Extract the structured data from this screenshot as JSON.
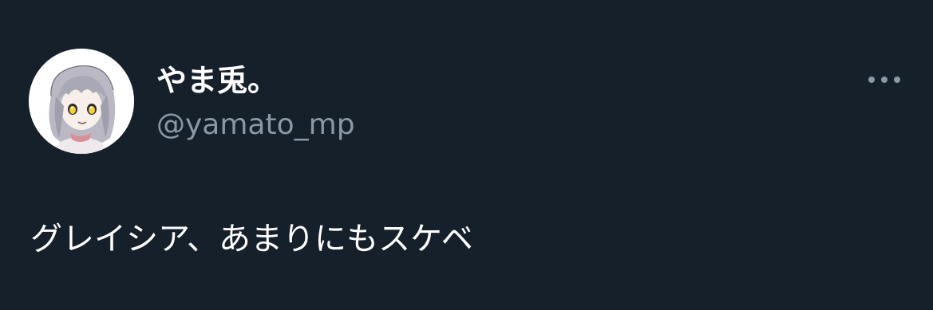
{
  "tweet": {
    "display_name": "やま兎。",
    "handle": "@yamato_mp",
    "text": "グレイシア、あまりにもスケベ"
  },
  "icons": {
    "more": "more-horizontal-icon",
    "avatar": "anime-girl-avatar"
  },
  "colors": {
    "background": "#15202b",
    "primary_text": "#ffffff",
    "secondary_text": "#8b98a5"
  }
}
